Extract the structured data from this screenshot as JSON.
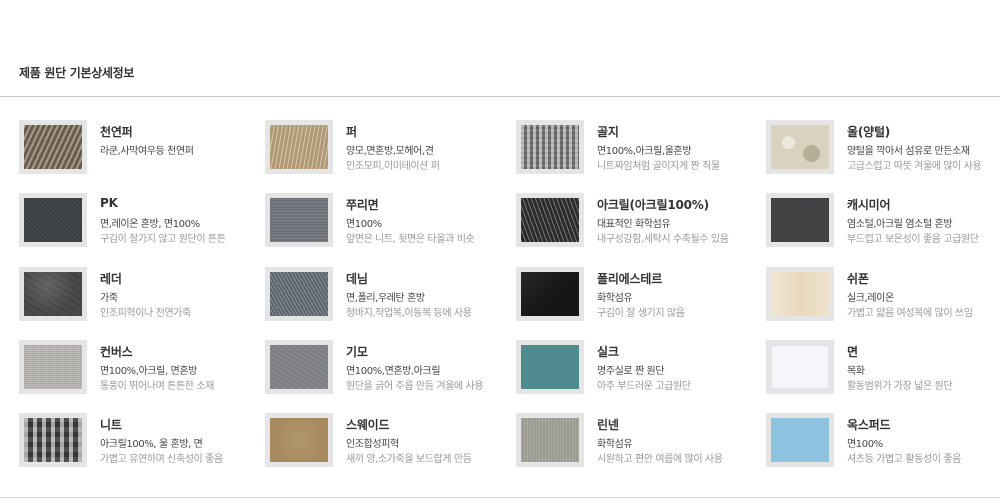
{
  "page": {
    "title": "제품 원단 기본상세정보"
  },
  "fabrics": [
    {
      "name": "천연퍼",
      "material": "라쿤,사막여우등 천연퍼",
      "desc": "",
      "swatch": "natural-fur",
      "color": "#8a7a66"
    },
    {
      "name": "퍼",
      "material": "양모,면혼방,모헤어,견",
      "desc": "인조모피,이미테이션 퍼",
      "swatch": "fur",
      "color": "#c9ad86"
    },
    {
      "name": "골지",
      "material": "면100%,아크릴,울혼방",
      "desc": "니트짜임처럼 골이지게 짠 직물",
      "swatch": "rib-knit",
      "color": "#9a9a9a"
    },
    {
      "name": "울(양털)",
      "material": "양털을 깍아서 섬유로 만든소재",
      "desc": "고급스럽고 따뜻 겨울에 많이 사용",
      "swatch": "wool",
      "color": "#d8d2bf"
    },
    {
      "name": "PK",
      "material": "면,레이온 혼방, 면100%",
      "desc": "구김이 잘가지 않고 원단이 튼튼",
      "swatch": "pk",
      "color": "#3a3d40"
    },
    {
      "name": "쭈리면",
      "material": "면100%",
      "desc": "앞면은 니트, 뒷면은 타올과 비슷",
      "swatch": "french-terry",
      "color": "#6e7077"
    },
    {
      "name": "아크릴(아크릴100%)",
      "material": "대표적인 화학섬유",
      "desc": "내구성강함,세탁시 수축될수 있음",
      "swatch": "acrylic",
      "color": "#2b2b2b"
    },
    {
      "name": "캐시미어",
      "material": "염소털,아크릴 염소털 혼방",
      "desc": "부드럽고 보온성이 좋음 고급원단",
      "swatch": "cashmere",
      "color": "#3d3d3f"
    },
    {
      "name": "레더",
      "material": "가죽",
      "desc": "인조피혁이나 천연가죽",
      "swatch": "leather",
      "color": "#4a4a4a"
    },
    {
      "name": "데님",
      "material": "면,폴리,우레탄 혼방",
      "desc": "청바지,작업복,이동복 등에 사용",
      "swatch": "denim",
      "color": "#59616b"
    },
    {
      "name": "폴리에스테르",
      "material": "화학섬유",
      "desc": "구김이 잘 생기지 않음",
      "swatch": "polyester",
      "color": "#151515"
    },
    {
      "name": "쉬폰",
      "material": "실크,레이온",
      "desc": "가볍고 얇음 여성복에 많이 쓰임",
      "swatch": "chiffon",
      "color": "#e9d8bd"
    },
    {
      "name": "컨버스",
      "material": "면100%,아크릴, 면혼방",
      "desc": "통풍이 뛰어나며 튼튼한 소재",
      "swatch": "canvas",
      "color": "#b4b2ac"
    },
    {
      "name": "기모",
      "material": "면100%,면혼방,아크릴",
      "desc": "원단을 긁어 주름 만듬 겨울에 사용",
      "swatch": "brushed",
      "color": "#7d7f83"
    },
    {
      "name": "실크",
      "material": "명주실로 짠 원단",
      "desc": "아주 부드러운 고급원단",
      "swatch": "silk",
      "color": "#4f8a8f"
    },
    {
      "name": "면",
      "material": "목화",
      "desc": "활동범위가 가장 넓은 원단",
      "swatch": "cotton",
      "color": "#f6f6fa"
    },
    {
      "name": "니트",
      "material": "아크릴100%, 울 혼방, 면",
      "desc": "가볍고 유연하며 신축성이 좋음",
      "swatch": "knit",
      "color": "#4c4c4c"
    },
    {
      "name": "스웨이드",
      "material": "인조합성피혁",
      "desc": "새끼 양,소가죽을 보드랍게 만듬",
      "swatch": "suede",
      "color": "#a88a5f"
    },
    {
      "name": "린넨",
      "material": "화학섬유",
      "desc": "시원하고 편안 여름에 많이 사용",
      "swatch": "linen",
      "color": "#9d9c94"
    },
    {
      "name": "옥스퍼드",
      "material": "면100%",
      "desc": "셔츠등 가볍고 활동성이 좋음",
      "swatch": "oxford",
      "color": "#8ec3df"
    }
  ]
}
